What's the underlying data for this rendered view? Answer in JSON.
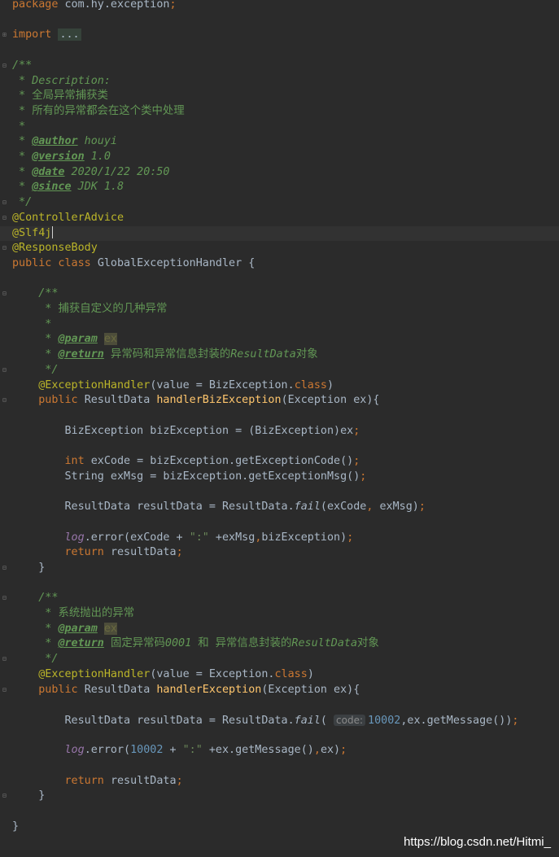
{
  "editor": {
    "lines": [
      {
        "fold": "",
        "caret": false,
        "spans": [
          [
            "kw",
            "package "
          ],
          [
            "",
            "com.hy.exception"
          ],
          [
            "kw",
            ";"
          ]
        ]
      },
      {
        "fold": "",
        "caret": false,
        "spans": []
      },
      {
        "fold": "+",
        "caret": false,
        "spans": [
          [
            "kw",
            "import "
          ],
          [
            "ellip",
            "..."
          ]
        ]
      },
      {
        "fold": "",
        "caret": false,
        "spans": []
      },
      {
        "fold": "-",
        "caret": false,
        "spans": [
          [
            "cm",
            "/**"
          ]
        ]
      },
      {
        "fold": "",
        "caret": false,
        "spans": [
          [
            "cm",
            " * Description:"
          ]
        ]
      },
      {
        "fold": "",
        "caret": false,
        "spans": [
          [
            "cm",
            " * "
          ],
          [
            "cmz",
            "全局异常捕获类"
          ]
        ]
      },
      {
        "fold": "",
        "caret": false,
        "spans": [
          [
            "cm",
            " * "
          ],
          [
            "cmz",
            "所有的异常都会在这个类中处理"
          ]
        ]
      },
      {
        "fold": "",
        "caret": false,
        "spans": [
          [
            "cm",
            " *"
          ]
        ]
      },
      {
        "fold": "",
        "caret": false,
        "spans": [
          [
            "cm",
            " * "
          ],
          [
            "tag",
            "@author"
          ],
          [
            "cm",
            " houyi"
          ]
        ]
      },
      {
        "fold": "",
        "caret": false,
        "spans": [
          [
            "cm",
            " * "
          ],
          [
            "tag",
            "@version"
          ],
          [
            "cm",
            " 1.0"
          ]
        ]
      },
      {
        "fold": "",
        "caret": false,
        "spans": [
          [
            "cm",
            " * "
          ],
          [
            "tag",
            "@date"
          ],
          [
            "cm",
            " 2020/1/22 20:50"
          ]
        ]
      },
      {
        "fold": "",
        "caret": false,
        "spans": [
          [
            "cm",
            " * "
          ],
          [
            "tag",
            "@since"
          ],
          [
            "cm",
            " JDK 1.8"
          ]
        ]
      },
      {
        "fold": "-",
        "caret": false,
        "spans": [
          [
            "cm",
            " */"
          ]
        ]
      },
      {
        "fold": "-",
        "caret": false,
        "spans": [
          [
            "ann",
            "@ControllerAdvice"
          ]
        ]
      },
      {
        "fold": "",
        "caret": true,
        "spans": [
          [
            "ann",
            "@Slf4j"
          ],
          [
            "cursor",
            ""
          ]
        ]
      },
      {
        "fold": "-",
        "caret": false,
        "spans": [
          [
            "ann",
            "@ResponseBody"
          ]
        ]
      },
      {
        "fold": "",
        "caret": false,
        "spans": [
          [
            "kw",
            "public class "
          ],
          [
            "",
            "GlobalExceptionHandler {"
          ]
        ]
      },
      {
        "fold": "",
        "caret": false,
        "spans": []
      },
      {
        "fold": "-",
        "caret": false,
        "spans": [
          [
            "cm",
            "    /**"
          ]
        ]
      },
      {
        "fold": "",
        "caret": false,
        "spans": [
          [
            "cm",
            "     * "
          ],
          [
            "cmz",
            "捕获自定义的几种异常"
          ]
        ]
      },
      {
        "fold": "",
        "caret": false,
        "spans": [
          [
            "cm",
            "     *"
          ]
        ]
      },
      {
        "fold": "",
        "caret": false,
        "spans": [
          [
            "cm",
            "     * "
          ],
          [
            "tag",
            "@param"
          ],
          [
            "cm",
            " "
          ],
          [
            "param-hl",
            "ex"
          ]
        ]
      },
      {
        "fold": "",
        "caret": false,
        "spans": [
          [
            "cm",
            "     * "
          ],
          [
            "tag",
            "@return"
          ],
          [
            "cm",
            " "
          ],
          [
            "cmz",
            "异常码和异常信息封装的"
          ],
          [
            "cm",
            "ResultData"
          ],
          [
            "cmz",
            "对象"
          ]
        ]
      },
      {
        "fold": "-",
        "caret": false,
        "spans": [
          [
            "cm",
            "     */"
          ]
        ]
      },
      {
        "fold": "",
        "caret": false,
        "spans": [
          [
            "ann",
            "    @ExceptionHandler"
          ],
          [
            "",
            "("
          ],
          [
            "fn",
            ""
          ],
          [
            "",
            "value = BizException."
          ],
          [
            "kw",
            "class"
          ],
          [
            "",
            ")"
          ]
        ]
      },
      {
        "fold": "-",
        "caret": false,
        "spans": [
          [
            "kw",
            "    public "
          ],
          [
            "",
            "ResultData "
          ],
          [
            "fn",
            "handlerBizException"
          ],
          [
            "",
            "(Exception ex){"
          ]
        ]
      },
      {
        "fold": "",
        "caret": false,
        "spans": []
      },
      {
        "fold": "",
        "caret": false,
        "spans": [
          [
            "",
            "        BizException bizException = (BizException)ex"
          ],
          [
            "kw",
            ";"
          ]
        ]
      },
      {
        "fold": "",
        "caret": false,
        "spans": []
      },
      {
        "fold": "",
        "caret": false,
        "spans": [
          [
            "kw",
            "        int "
          ],
          [
            "",
            "exCode = bizException.getExceptionCode()"
          ],
          [
            "kw",
            ";"
          ]
        ]
      },
      {
        "fold": "",
        "caret": false,
        "spans": [
          [
            "",
            "        String exMsg = bizException.getExceptionMsg()"
          ],
          [
            "kw",
            ";"
          ]
        ]
      },
      {
        "fold": "",
        "caret": false,
        "spans": []
      },
      {
        "fold": "",
        "caret": false,
        "spans": [
          [
            "",
            "        ResultData resultData = ResultData."
          ],
          [
            "ital",
            "fail"
          ],
          [
            "",
            "(exCode"
          ],
          [
            "kw",
            ", "
          ],
          [
            "",
            "exMsg)"
          ],
          [
            "kw",
            ";"
          ]
        ]
      },
      {
        "fold": "",
        "caret": false,
        "spans": []
      },
      {
        "fold": "",
        "caret": false,
        "spans": [
          [
            "stat",
            "        log"
          ],
          [
            "",
            ".error(exCode + "
          ],
          [
            "str",
            "\":\""
          ],
          [
            "",
            " +exMsg"
          ],
          [
            "kw",
            ","
          ],
          [
            "",
            "bizException)"
          ],
          [
            "kw",
            ";"
          ]
        ]
      },
      {
        "fold": "",
        "caret": false,
        "spans": [
          [
            "kw",
            "        return "
          ],
          [
            "",
            "resultData"
          ],
          [
            "kw",
            ";"
          ]
        ]
      },
      {
        "fold": "-",
        "caret": false,
        "spans": [
          [
            "",
            "    }"
          ]
        ]
      },
      {
        "fold": "",
        "caret": false,
        "spans": []
      },
      {
        "fold": "-",
        "caret": false,
        "spans": [
          [
            "cm",
            "    /**"
          ]
        ]
      },
      {
        "fold": "",
        "caret": false,
        "spans": [
          [
            "cm",
            "     * "
          ],
          [
            "cmz",
            "系统抛出的异常"
          ]
        ]
      },
      {
        "fold": "",
        "caret": false,
        "spans": [
          [
            "cm",
            "     * "
          ],
          [
            "tag",
            "@param"
          ],
          [
            "cm",
            " "
          ],
          [
            "param-hl",
            "ex"
          ]
        ]
      },
      {
        "fold": "",
        "caret": false,
        "spans": [
          [
            "cm",
            "     * "
          ],
          [
            "tag",
            "@return"
          ],
          [
            "cm",
            " "
          ],
          [
            "cmz",
            "固定异常码"
          ],
          [
            "cm",
            "0001 "
          ],
          [
            "cmz",
            "和 异常信息封装的"
          ],
          [
            "cm",
            "ResultData"
          ],
          [
            "cmz",
            "对象"
          ]
        ]
      },
      {
        "fold": "-",
        "caret": false,
        "spans": [
          [
            "cm",
            "     */"
          ]
        ]
      },
      {
        "fold": "",
        "caret": false,
        "spans": [
          [
            "ann",
            "    @ExceptionHandler"
          ],
          [
            "",
            "(value = Exception."
          ],
          [
            "kw",
            "class"
          ],
          [
            "",
            ")"
          ]
        ]
      },
      {
        "fold": "-",
        "caret": false,
        "spans": [
          [
            "kw",
            "    public "
          ],
          [
            "",
            "ResultData "
          ],
          [
            "fn",
            "handlerException"
          ],
          [
            "",
            "(Exception ex){"
          ]
        ]
      },
      {
        "fold": "",
        "caret": false,
        "spans": []
      },
      {
        "fold": "",
        "caret": false,
        "spans": [
          [
            "",
            "        ResultData resultData = ResultData."
          ],
          [
            "ital",
            "fail"
          ],
          [
            "",
            "( "
          ],
          [
            "hint",
            "code:"
          ],
          [
            "num",
            "10002"
          ],
          [
            "",
            ",ex.getMessage())"
          ],
          [
            "kw",
            ";"
          ]
        ]
      },
      {
        "fold": "",
        "caret": false,
        "spans": []
      },
      {
        "fold": "",
        "caret": false,
        "spans": [
          [
            "stat",
            "        log"
          ],
          [
            "",
            ".error("
          ],
          [
            "num",
            "10002"
          ],
          [
            "",
            " + "
          ],
          [
            "str",
            "\":\""
          ],
          [
            "",
            " +ex.getMessage()"
          ],
          [
            "kw",
            ","
          ],
          [
            "",
            "ex)"
          ],
          [
            "kw",
            ";"
          ]
        ]
      },
      {
        "fold": "",
        "caret": false,
        "spans": []
      },
      {
        "fold": "",
        "caret": false,
        "spans": [
          [
            "kw",
            "        return "
          ],
          [
            "",
            "resultData"
          ],
          [
            "kw",
            ";"
          ]
        ]
      },
      {
        "fold": "-",
        "caret": false,
        "spans": [
          [
            "",
            "    }"
          ]
        ]
      },
      {
        "fold": "",
        "caret": false,
        "spans": []
      },
      {
        "fold": "",
        "caret": false,
        "spans": [
          [
            "",
            "}"
          ]
        ]
      }
    ]
  },
  "watermark": "https://blog.csdn.net/Hitmi_"
}
